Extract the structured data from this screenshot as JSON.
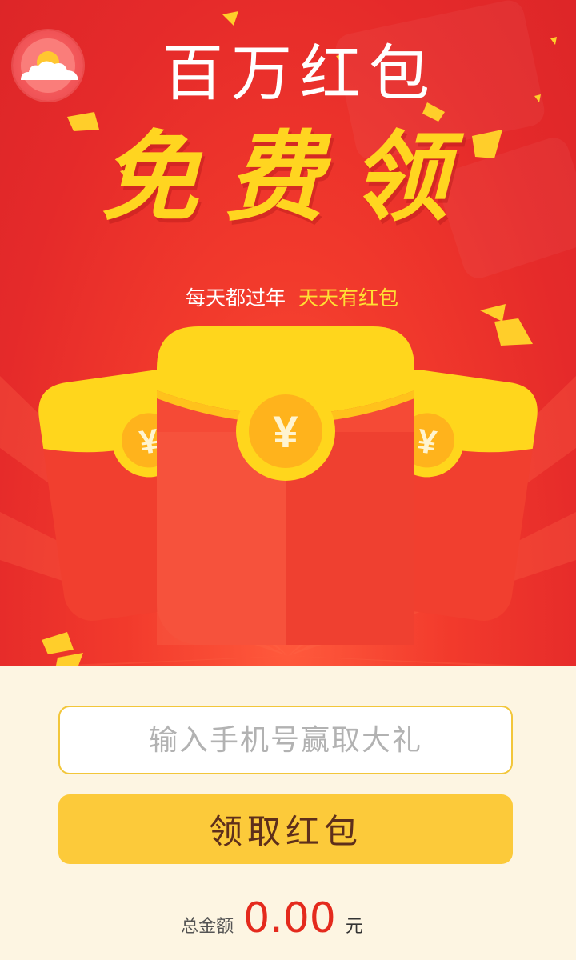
{
  "hero": {
    "title": "百万红包",
    "headline": "免费领",
    "subtitle_white": "每天都过年",
    "subtitle_yellow": "天天有红包",
    "envelope_symbol": "¥",
    "logo_icon": "sun-cloud-icon"
  },
  "form": {
    "phone_placeholder": "输入手机号赢取大礼",
    "phone_value": "",
    "claim_button_label": "领取红包"
  },
  "total": {
    "label": "总金额",
    "amount": "0.00",
    "unit": "元"
  },
  "colors": {
    "hero_red": "#e52a2a",
    "gold": "#ffd520",
    "button_yellow": "#fcca3a",
    "button_text": "#5e2f1b",
    "amount_red": "#e42a1d",
    "form_bg": "#fdf5e2"
  }
}
